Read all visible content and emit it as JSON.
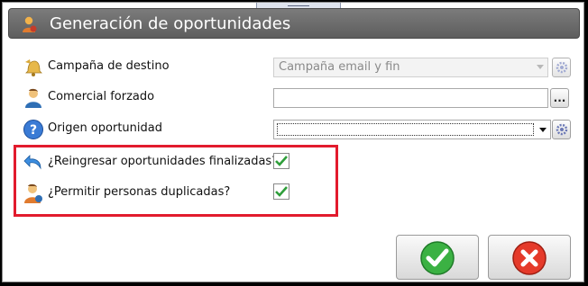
{
  "dialog": {
    "title": "Generación de oportunidades"
  },
  "fields": {
    "campaign": {
      "label": "Campaña de destino",
      "value": "Campaña email y fin",
      "icon": "bell-icon"
    },
    "sales_rep": {
      "label": "Comercial forzado",
      "value": "",
      "button_label": "...",
      "icon": "person-icon"
    },
    "origin": {
      "label": "Origen oportunidad",
      "value": "",
      "icon": "help-icon"
    }
  },
  "options": {
    "reopen": {
      "label": "¿Reingresar oportunidades finalizadas?",
      "checked": true,
      "icon": "undo-arrow-icon"
    },
    "duplicates": {
      "label": "¿Permitir personas duplicadas?",
      "checked": true,
      "icon": "person-plus-icon"
    }
  },
  "actions": {
    "ok": "ok-icon",
    "cancel": "cancel-icon"
  },
  "colors": {
    "titlebar": "#666666",
    "highlight": "#e21b2d",
    "ok": "#3bb143",
    "cancel": "#e53a2a"
  }
}
